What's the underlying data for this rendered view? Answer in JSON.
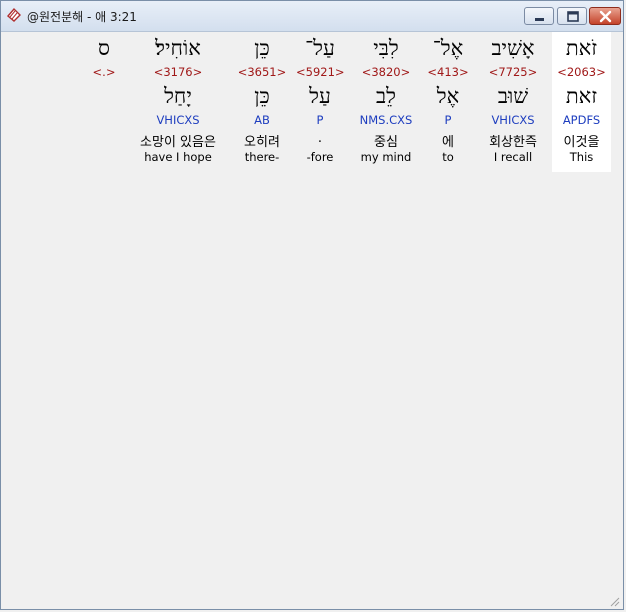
{
  "window": {
    "title": "@원전분해 - 애 3:21"
  },
  "words": [
    {
      "hebrew": "זֹאת",
      "strong": "<2063>",
      "lemma": "זאת",
      "morph": "APDFS",
      "korean": "이것을",
      "english": "This",
      "highlighted": true
    },
    {
      "hebrew": "אָשִׁיב",
      "strong": "<7725>",
      "lemma": "שׁוּב",
      "morph": "VHICXS",
      "korean": "회상한즉",
      "english": "I recall",
      "highlighted": false
    },
    {
      "hebrew": "אֶל־",
      "strong": "<413>",
      "lemma": "אֶל",
      "morph": "P",
      "korean": "에",
      "english": "to",
      "highlighted": false
    },
    {
      "hebrew": "לִבִּי",
      "strong": "<3820>",
      "lemma": "לֵב",
      "morph": "NMS.CXS",
      "korean": "중심",
      "english": "my mind",
      "highlighted": false
    },
    {
      "hebrew": "עַל־",
      "strong": "<5921>",
      "lemma": "עַל",
      "morph": "P",
      "korean": ".",
      "english": "-fore",
      "highlighted": false
    },
    {
      "hebrew": "כֵּן",
      "strong": "<3651>",
      "lemma": "כֵּן",
      "morph": "AB",
      "korean": "오히려",
      "english": "there-",
      "highlighted": false
    },
    {
      "hebrew": "אוֹחִיל׃",
      "strong": "<3176>",
      "lemma": "יָחַל",
      "morph": "VHICXS",
      "korean": "소망이 있음은",
      "english": "have I hope",
      "highlighted": false
    },
    {
      "hebrew": "ס",
      "strong": "<.>",
      "lemma": "",
      "morph": "",
      "korean": "",
      "english": "",
      "highlighted": false
    }
  ],
  "colors": {
    "strong": "#a01818",
    "morph": "#1d3dbf",
    "highlight": "#ffffff"
  }
}
